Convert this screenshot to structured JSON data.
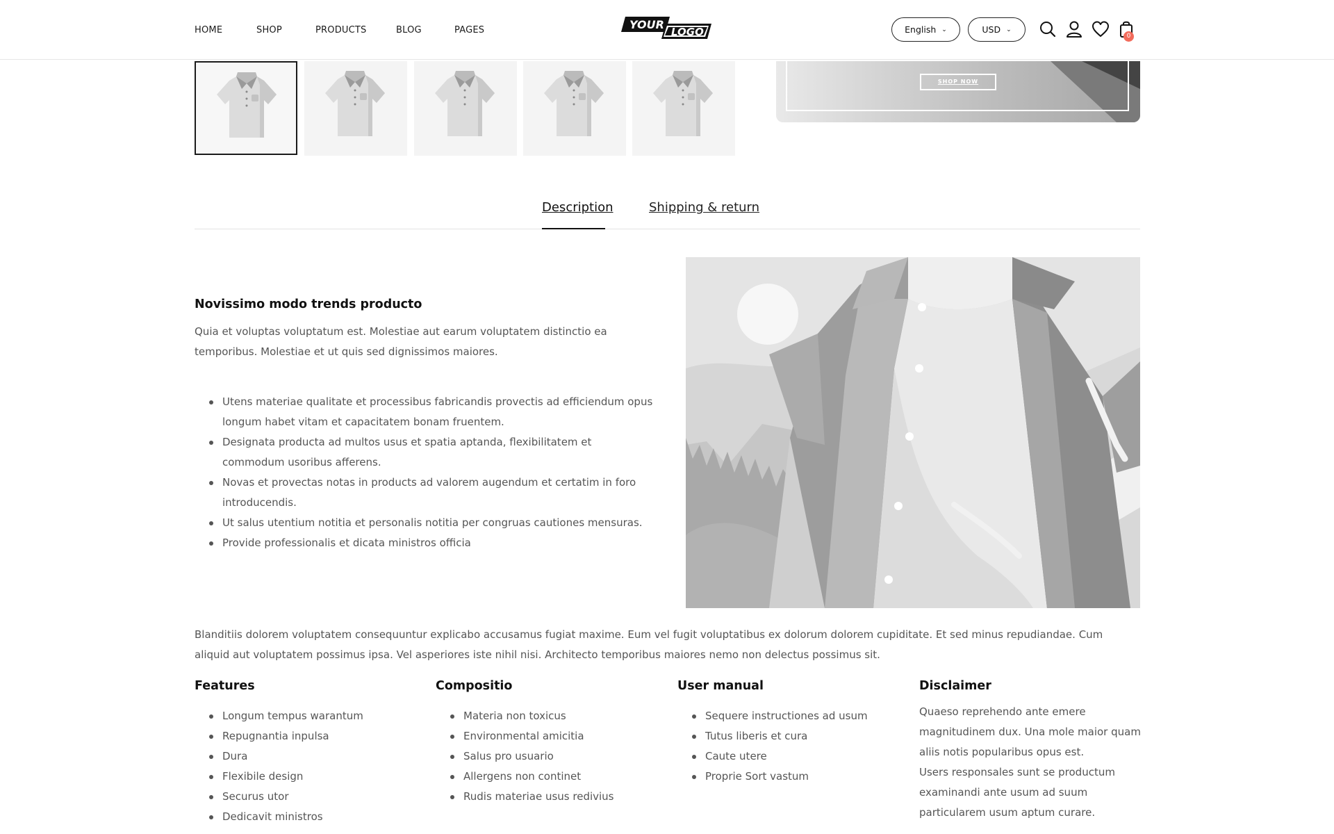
{
  "header": {
    "nav": [
      {
        "label": "HOME"
      },
      {
        "label": "SHOP"
      },
      {
        "label": "PRODUCTS"
      },
      {
        "label": "BLOG"
      },
      {
        "label": "PAGES"
      }
    ],
    "logo": {
      "top": "YOUR",
      "bottom": "LOGO"
    },
    "language": "English",
    "currency": "USD",
    "cart_count": "0",
    "icons": [
      "search-icon",
      "user-icon",
      "heart-icon",
      "shopping-bag-icon"
    ]
  },
  "thumbnails": [
    {
      "name": "shirt-thumbnail-1",
      "active": true
    },
    {
      "name": "shirt-thumbnail-2",
      "active": false
    },
    {
      "name": "shirt-thumbnail-3",
      "active": false
    },
    {
      "name": "shirt-thumbnail-4",
      "active": false
    },
    {
      "name": "shirt-thumbnail-5",
      "active": false
    }
  ],
  "promo": {
    "button_label": "SHOP NOW"
  },
  "tabs": [
    {
      "label": "Description",
      "active": true
    },
    {
      "label": "Shipping & return",
      "active": false
    }
  ],
  "description": {
    "heading": "Novissimo modo trends producto",
    "intro": "Quia et voluptas voluptatum est. Molestiae aut earum voluptatem distinctio ea temporibus. Molestiae et ut quis sed dignissimos maiores.",
    "bullets": [
      "Utens materiae qualitate et processibus fabricandis provectis ad efficiendum opus longum habet vitam et capacitatem bonam fruentem.",
      "Designata producta ad multos usus et spatia aptanda, flexibilitatem et commodum usoribus afferens.",
      "Novas et provectas notas in products ad valorem augendum et certatim in foro introducendis.",
      "Ut salus utentium notitia et personalis notitia per congruas cautiones mensuras.",
      "Provide professionalis et dicata ministros officia"
    ],
    "long_paragraph": "Blanditiis dolorem voluptatem consequuntur explicabo accusamus fugiat maxime. Eum vel fugit voluptatibus ex dolorum dolorem cupiditate. Et sed minus repudiandae. Cum aliquid aut voluptatem possimus ipsa. Vel asperiores iste nihil nisi. Architecto temporibus maiores nemo non delectus possimus sit."
  },
  "columns": {
    "features": {
      "heading": "Features",
      "items": [
        "Longum tempus warantum",
        "Repugnantia inpulsa",
        "Dura",
        "Flexibile design",
        "Securus utor",
        "Dedicavit ministros"
      ]
    },
    "compositio": {
      "heading": "Compositio",
      "items": [
        "Materia non toxicus",
        "Environmental amicitia",
        "Salus pro usuario",
        "Allergens non continet",
        "Rudis materiae usus redivius"
      ]
    },
    "user_manual": {
      "heading": "User manual",
      "items": [
        "Sequere instructiones ad usum",
        "Tutus liberis et cura",
        "Caute utere",
        "Proprie Sort vastum"
      ]
    },
    "disclaimer": {
      "heading": "Disclaimer",
      "para1": "Quaeso reprehendo ante emere magnitudinem dux. Una mole maior quam aliis notis popularibus opus est.",
      "para2": "Users responsales sunt se productum examinandi ante usum ad suum particularem usum aptum curare."
    }
  }
}
